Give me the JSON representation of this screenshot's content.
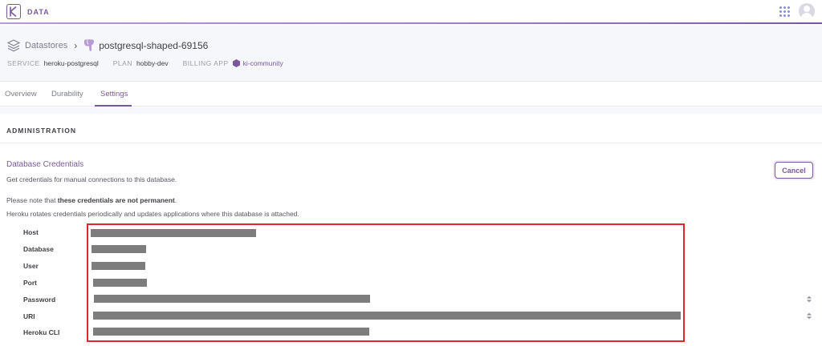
{
  "topnav": {
    "brand": "DATA",
    "logo_icon": "heroku-logo-icon",
    "apps_icon": "apps-grid-icon",
    "avatar_icon": "user-avatar-icon",
    "accent_color": "#79589f"
  },
  "breadcrumb": {
    "root_label": "Datastores",
    "root_icon": "datastores-stack-icon",
    "separator": "›",
    "db_icon": "postgresql-elephant-icon",
    "db_name": "postgresql-shaped-69156"
  },
  "meta": {
    "service_label": "SERVICE",
    "service_value": "heroku-postgresql",
    "plan_label": "PLAN",
    "plan_value": "hobby-dev",
    "billing_label": "BILLING APP",
    "billing_icon": "app-hexagon-icon",
    "billing_value": "ki-community"
  },
  "tabs": [
    {
      "label": "Overview",
      "active": false
    },
    {
      "label": "Durability",
      "active": false
    },
    {
      "label": "Settings",
      "active": true
    }
  ],
  "administration": {
    "title": "ADMINISTRATION",
    "credentials": {
      "title": "Database Credentials",
      "subtitle": "Get credentials for manual connections to this database.",
      "note_prefix": "Please note that ",
      "note_bold": "these credentials are not permanent",
      "note_suffix": ".",
      "note2": "Heroku rotates credentials periodically and updates applications where this database is attached.",
      "cancel_label": "Cancel",
      "fields": [
        {
          "label": "Host",
          "redacted": true
        },
        {
          "label": "Database",
          "redacted": true
        },
        {
          "label": "User",
          "redacted": true
        },
        {
          "label": "Port",
          "redacted": true
        },
        {
          "label": "Password",
          "redacted": true
        },
        {
          "label": "URI",
          "redacted": true
        },
        {
          "label": "Heroku CLI",
          "redacted": true
        }
      ]
    }
  },
  "colors": {
    "highlight_box": "#e0262b",
    "redaction": "#7d7d7d",
    "header_bg": "#f6f7fb"
  }
}
